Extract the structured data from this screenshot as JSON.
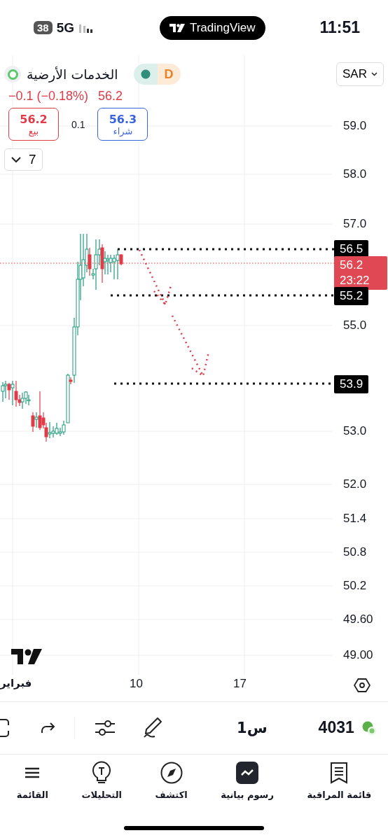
{
  "status_bar": {
    "battery": "38",
    "network": "5G",
    "app_pill": "TradingView",
    "time": "11:51"
  },
  "symbol": {
    "name": "الخدمات الأرضية",
    "interval": "D",
    "price": "56.2",
    "change": "−0.1 (−0.18%)",
    "currency": "SAR"
  },
  "order": {
    "sell_price": "56.2",
    "sell_label": "بيع",
    "spread": "0.1",
    "buy_price": "56.3",
    "buy_label": "شراء"
  },
  "indicators_toggle": {
    "count": "7",
    "expanded": false
  },
  "price_axis": [
    "59.0",
    "58.0",
    "57.0",
    "55.0",
    "53.0",
    "52.0",
    "51.4",
    "50.8",
    "50.2",
    "49.60",
    "49.00"
  ],
  "price_tags": [
    {
      "kind": "level",
      "price": "56.5"
    },
    {
      "kind": "last",
      "price": "56.2",
      "countdown": "23:22"
    },
    {
      "kind": "level",
      "price": "55.2"
    },
    {
      "kind": "level",
      "price": "53.9"
    }
  ],
  "time_axis": [
    "فبراير",
    "10",
    "17"
  ],
  "toolbar": {
    "timeframe": "1س",
    "symbol_number": "4031"
  },
  "nav": [
    {
      "label": "قائمة المراقبة",
      "selected": false
    },
    {
      "label": "رسوم بيانية",
      "selected": true
    },
    {
      "label": "اكتشف",
      "selected": false
    },
    {
      "label": "التحليلات",
      "selected": false
    },
    {
      "label": "القائمة",
      "selected": false
    }
  ]
}
